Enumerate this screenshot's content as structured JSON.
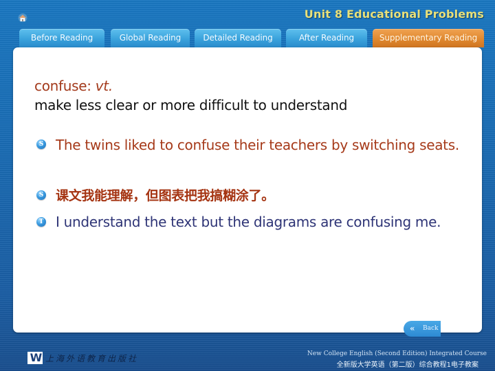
{
  "header": {
    "home_icon": "home-icon",
    "unit_title": "Unit 8 Educational Problems"
  },
  "tabs": [
    {
      "label": "Before Reading",
      "active": false
    },
    {
      "label": "Global Reading",
      "active": false
    },
    {
      "label": "Detailed Reading",
      "active": false
    },
    {
      "label": "After Reading",
      "active": false
    },
    {
      "label": "Supplementary Reading",
      "active": true
    }
  ],
  "content": {
    "word": "confuse:",
    "part_of_speech": "vt.",
    "definition": "make less clear or more difficult to understand",
    "examples": [
      {
        "badge": "S",
        "icon": "sentence-bullet-icon",
        "text": "The twins liked to confuse their teachers by switching seats."
      },
      {
        "badge": "S",
        "icon": "sentence-bullet-icon",
        "text": "课文我能理解，但图表把我搞糊涂了。"
      },
      {
        "badge": "T",
        "icon": "translation-bullet-icon",
        "text": "I understand the text but the diagrams are confusing me."
      }
    ]
  },
  "navigation": {
    "back_label": "Back",
    "back_icon": "double-chevron-left-icon"
  },
  "footer": {
    "publisher_logo": "W",
    "publisher_name": "上海外语教育出版社",
    "course_en": "New College English (Second Edition) Integrated Course",
    "course_zh": "全新版大学英语（第二版）综合教程1电子教案"
  },
  "colors": {
    "active_tab": "#e08930",
    "tab": "#3aa2dc",
    "unit_title": "#e8e07a",
    "word_red": "#a33a1c",
    "translation_blue": "#2e3476"
  }
}
